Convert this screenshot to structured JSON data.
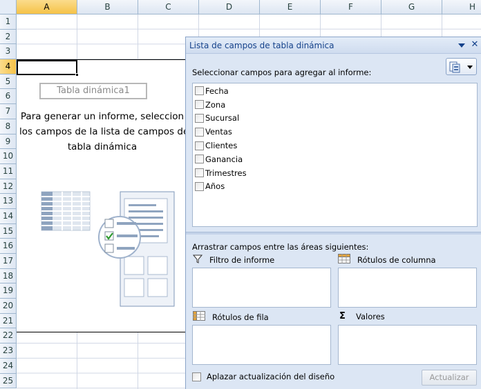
{
  "sheet": {
    "columns": [
      "A",
      "B",
      "C",
      "D",
      "E",
      "F",
      "G",
      "H"
    ],
    "rows": [
      "1",
      "2",
      "3",
      "4",
      "5",
      "6",
      "7",
      "8",
      "9",
      "10",
      "11",
      "12",
      "13",
      "14",
      "15",
      "16",
      "17",
      "18",
      "19",
      "20",
      "21",
      "22",
      "23",
      "24",
      "25"
    ],
    "selected_column": "A",
    "selected_row": "4"
  },
  "pivot": {
    "name": "Tabla dinámica1",
    "message_line1": "Para generar un informe, seleccion",
    "message_line2": "los campos de la lista de campos de",
    "message_line3": "tabla dinámica"
  },
  "pane": {
    "title": "Lista de campos de tabla dinámica",
    "select_label": "Seleccionar campos para agregar al informe:",
    "fields": [
      {
        "label": "Fecha",
        "checked": false
      },
      {
        "label": "Zona",
        "checked": false
      },
      {
        "label": "Sucursal",
        "checked": false
      },
      {
        "label": "Ventas",
        "checked": false
      },
      {
        "label": "Clientes",
        "checked": false
      },
      {
        "label": "Ganancia",
        "checked": false
      },
      {
        "label": "Trimestres",
        "checked": false
      },
      {
        "label": "Años",
        "checked": false
      }
    ],
    "drag_label": "Arrastrar campos entre las áreas siguientes:",
    "areas": {
      "report_filter": "Filtro de informe",
      "column_labels": "Rótulos de columna",
      "row_labels": "Rótulos de fila",
      "values": "Valores"
    },
    "defer_label": "Aplazar actualización del diseño",
    "update_button": "Actualizar"
  },
  "colors": {
    "header_bg": "#dde6f2",
    "selected_header": "#f5c248",
    "pane_bg": "#dce6f4",
    "pane_title_text": "#15428b",
    "gridline": "#d0d7e5"
  },
  "icons": {
    "pane_dropdown": "triangle-down-icon",
    "pane_close": "close-icon",
    "layout": "layout-options-icon",
    "report_filter": "funnel-icon",
    "column_labels": "grid-columns-icon",
    "row_labels": "grid-rows-icon",
    "values": "sigma-icon"
  }
}
